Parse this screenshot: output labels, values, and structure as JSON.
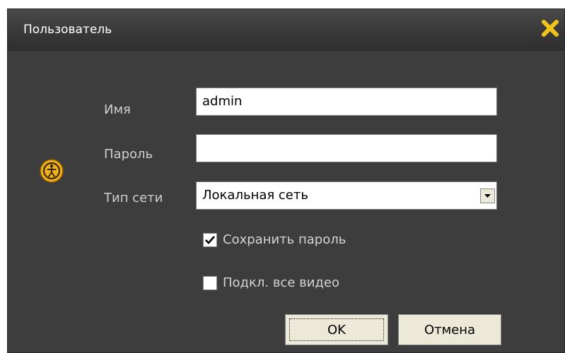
{
  "window": {
    "title": "Пользователь"
  },
  "form": {
    "username_label": "Имя",
    "username_value": "admin",
    "password_label": "Пароль",
    "password_value": "",
    "network_label": "Тип сети",
    "network_value": "Локальная сеть"
  },
  "options": {
    "save_password_label": "Сохранить пароль",
    "save_password_checked": true,
    "connect_all_video_label": "Подкл. все видео",
    "connect_all_video_checked": false
  },
  "buttons": {
    "ok_label": "OK",
    "cancel_label": "Отмена"
  },
  "colors": {
    "dialog_bg": "#3d3d3d",
    "close_icon": "#f0c419",
    "user_icon": "#f0b020"
  },
  "icons": {
    "close": "close-icon",
    "user": "user-icon",
    "dropdown": "chevron-down-icon",
    "check": "checkmark-icon"
  }
}
